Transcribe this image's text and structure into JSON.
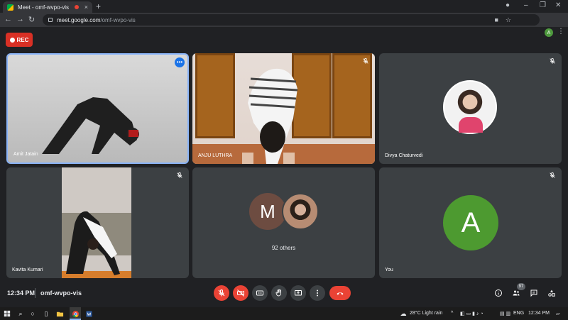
{
  "browser": {
    "tab_title": "Meet - omf-wvpo-vis",
    "tab_close": "×",
    "new_tab": "+",
    "url_host": "meet.google.com",
    "url_path": "/omf-wvpo-vis",
    "profile_initial": "A",
    "window_controls": [
      "–",
      "❐",
      "✕"
    ]
  },
  "meeting": {
    "rec_label": "REC",
    "time": "12:34 PM",
    "code": "omf-wvpo-vis",
    "participants_count": "97",
    "others_label": "92 others",
    "others_initial": "M",
    "self_initial": "A"
  },
  "participants": [
    {
      "name": "Amit Jatain",
      "muted": false,
      "active": true
    },
    {
      "name": "ANJU LUTHRA",
      "muted": true,
      "active": false
    },
    {
      "name": "Divya Chaturvedi",
      "muted": true,
      "active": false
    },
    {
      "name": "Kavita Kumari",
      "muted": true,
      "active": false
    },
    {
      "name": "You",
      "muted": true,
      "active": false
    }
  ],
  "taskbar": {
    "weather": "28°C  Light rain",
    "lang": "ENG",
    "time": "12:34 PM"
  },
  "colors": {
    "accent": "#8ab4f8",
    "danger": "#ea4335",
    "tile_bg": "#3c4043",
    "stage_bg": "#202124",
    "self_avatar": "#4d9a30",
    "other_avatar": "#6d4c41"
  }
}
